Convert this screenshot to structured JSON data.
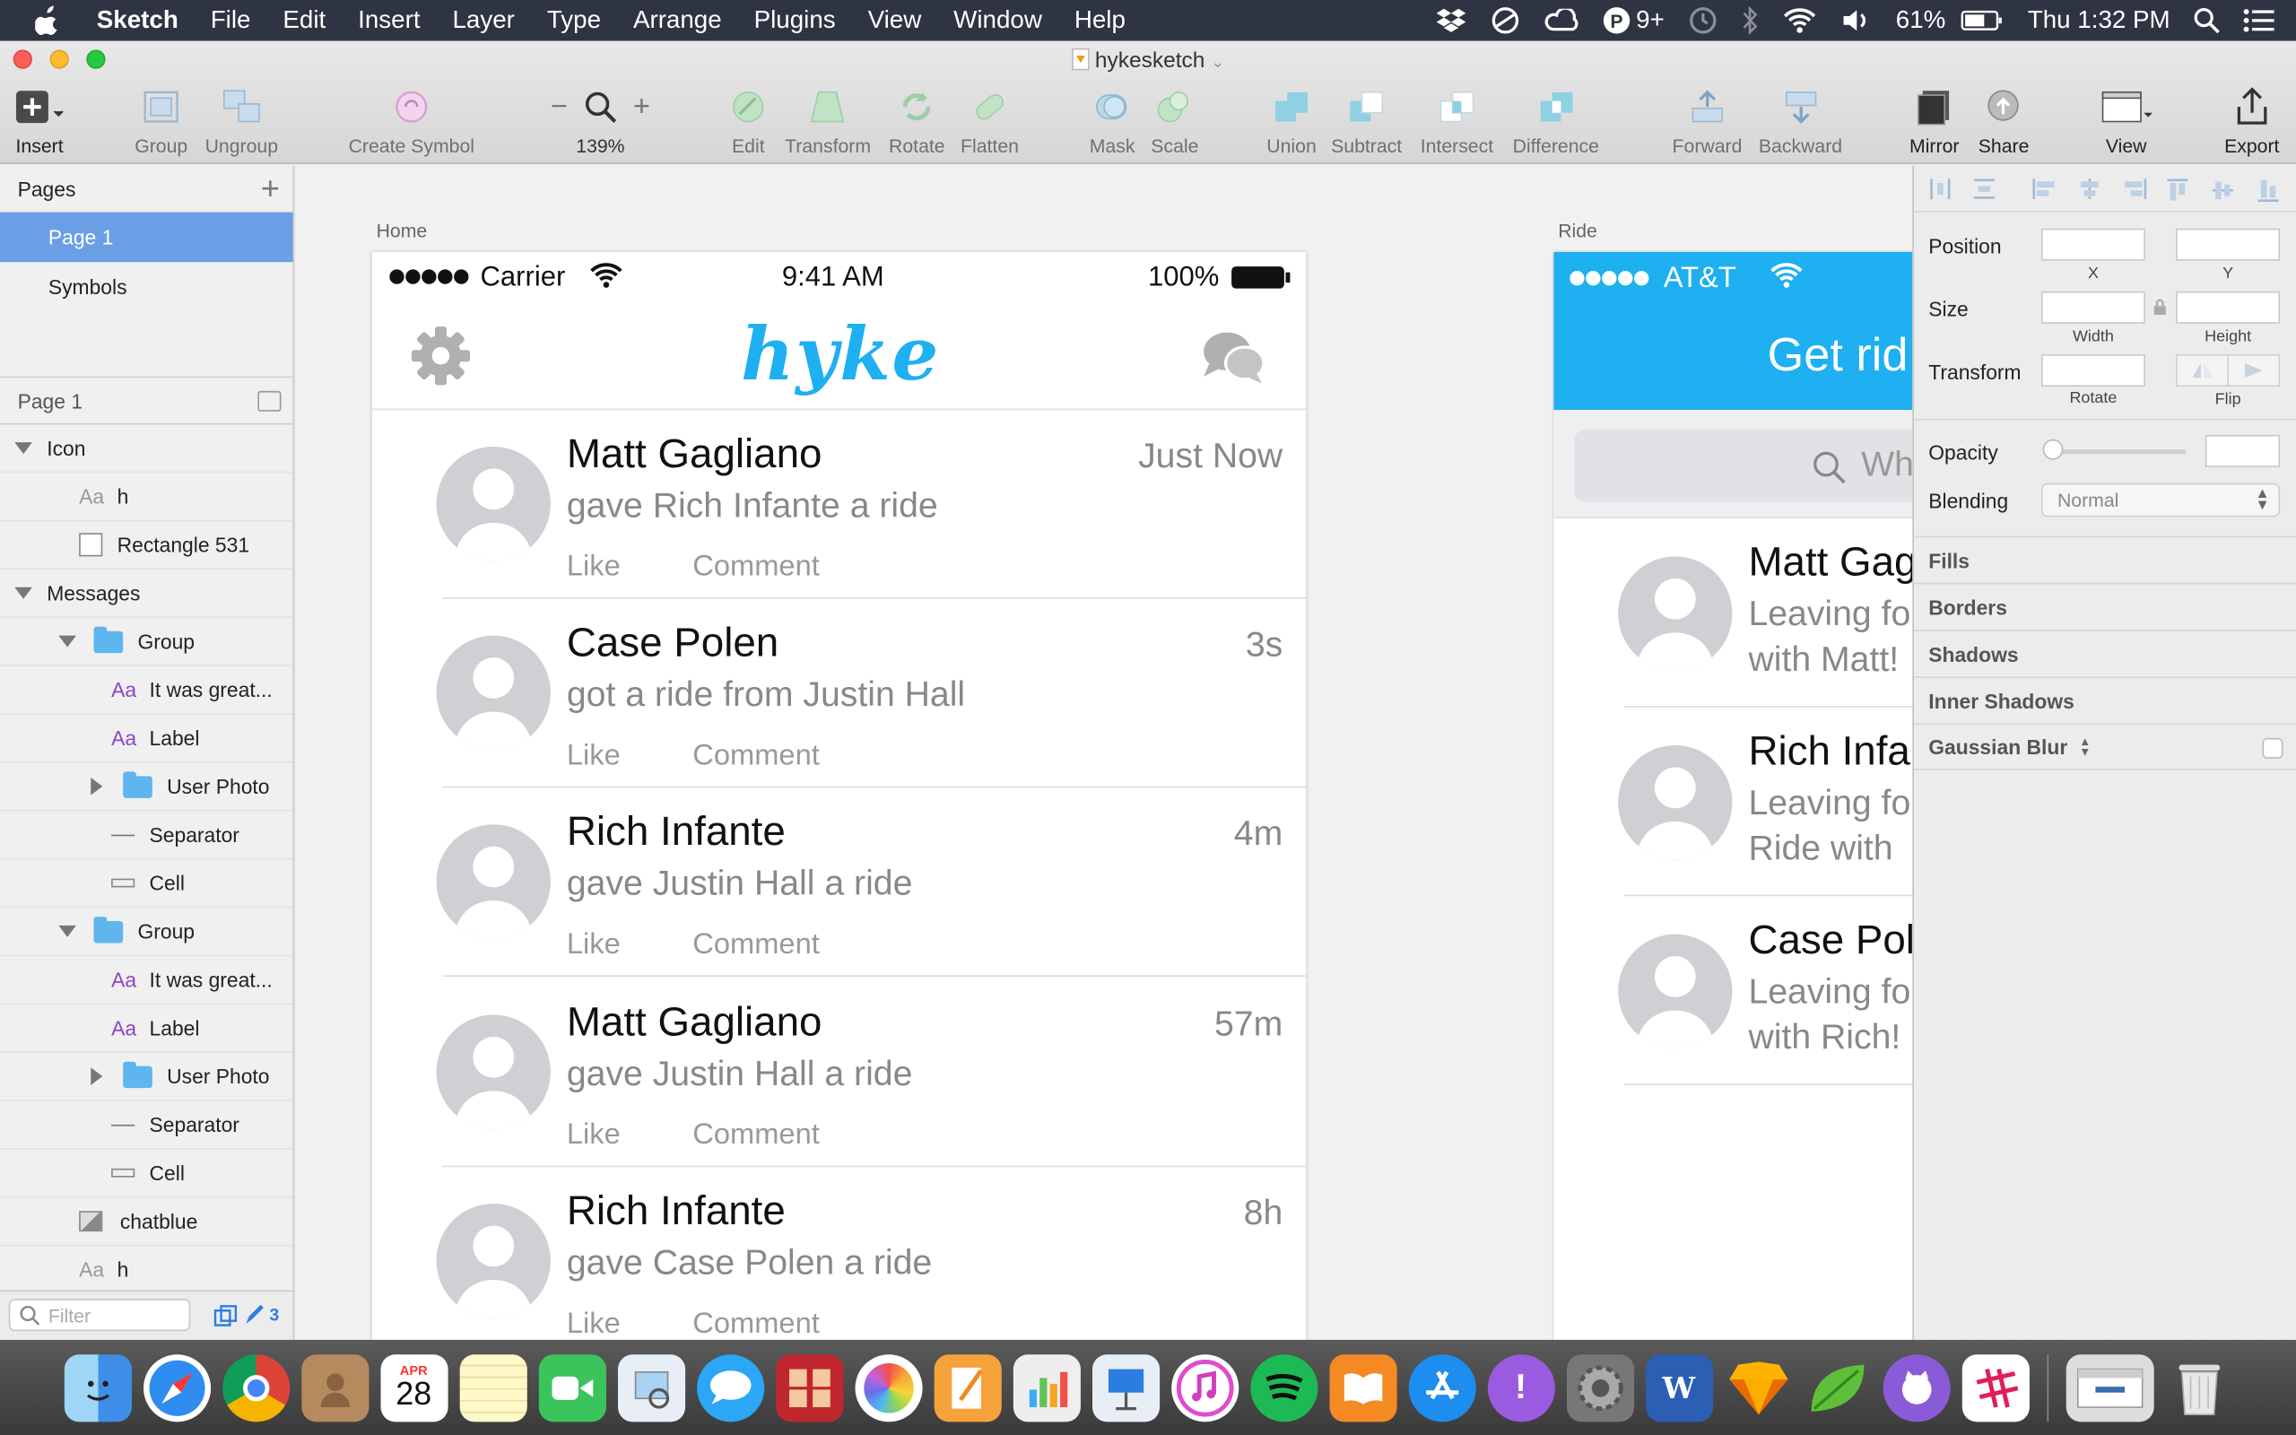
{
  "menubar": {
    "app": "Sketch",
    "menus": [
      "File",
      "Edit",
      "Insert",
      "Layer",
      "Type",
      "Arrange",
      "Plugins",
      "View",
      "Window",
      "Help"
    ],
    "status": {
      "notif_count": "9+",
      "battery": "61%",
      "clock": "Thu 1:32 PM"
    }
  },
  "window": {
    "title": "hykesketch",
    "toolbar": {
      "insert": "Insert",
      "group": "Group",
      "ungroup": "Ungroup",
      "create_symbol": "Create Symbol",
      "zoom": "139%",
      "edit": "Edit",
      "transform": "Transform",
      "rotate": "Rotate",
      "flatten": "Flatten",
      "mask": "Mask",
      "scale": "Scale",
      "union": "Union",
      "subtract": "Subtract",
      "intersect": "Intersect",
      "difference": "Difference",
      "forward": "Forward",
      "backward": "Backward",
      "mirror": "Mirror",
      "share": "Share",
      "view": "View",
      "export": "Export"
    }
  },
  "sidebar": {
    "pages_header": "Pages",
    "pages": [
      "Page 1",
      "Symbols"
    ],
    "layers_header": "Page 1",
    "filter_placeholder": "Filter",
    "filter_count": "3",
    "layers": [
      {
        "label": "Icon",
        "kind": "group-open",
        "indent": 0
      },
      {
        "label": "h",
        "kind": "text-gray",
        "indent": 1
      },
      {
        "label": "Rectangle 531",
        "kind": "rect",
        "indent": 1
      },
      {
        "label": "Messages",
        "kind": "group-open",
        "indent": 0
      },
      {
        "label": "Group",
        "kind": "folder-open",
        "indent": 1
      },
      {
        "label": "It was great...",
        "kind": "text",
        "indent": 2
      },
      {
        "label": "Label",
        "kind": "text",
        "indent": 2
      },
      {
        "label": "User Photo",
        "kind": "folder-closed",
        "indent": 2
      },
      {
        "label": "Separator",
        "kind": "line",
        "indent": 2
      },
      {
        "label": "Cell",
        "kind": "cell",
        "indent": 2
      },
      {
        "label": "Group",
        "kind": "folder-open",
        "indent": 1
      },
      {
        "label": "It was great...",
        "kind": "text",
        "indent": 2
      },
      {
        "label": "Label",
        "kind": "text",
        "indent": 2
      },
      {
        "label": "User Photo",
        "kind": "folder-closed",
        "indent": 2
      },
      {
        "label": "Separator",
        "kind": "line",
        "indent": 2
      },
      {
        "label": "Cell",
        "kind": "cell",
        "indent": 2
      },
      {
        "label": "chatblue",
        "kind": "image",
        "indent": 1
      },
      {
        "label": "h",
        "kind": "text-gray",
        "indent": 1
      }
    ]
  },
  "canvas": {
    "home_label": "Home",
    "ride_label": "Ride",
    "home": {
      "carrier": "Carrier",
      "time": "9:41 AM",
      "battery": "100%",
      "logo": "hyke",
      "feed": [
        {
          "name": "Matt Gagliano",
          "action": "gave Rich Infante a ride",
          "time": "Just Now",
          "like": "Like",
          "comment": "Comment"
        },
        {
          "name": "Case Polen",
          "action": "got a ride from Justin Hall",
          "time": "3s",
          "like": "Like",
          "comment": "Comment"
        },
        {
          "name": "Rich Infante",
          "action": "gave Justin Hall a ride",
          "time": "4m",
          "like": "Like",
          "comment": "Comment"
        },
        {
          "name": "Matt Gagliano",
          "action": "gave Justin Hall a ride",
          "time": "57m",
          "like": "Like",
          "comment": "Comment"
        },
        {
          "name": "Rich Infante",
          "action": "gave Case Polen a ride",
          "time": "8h",
          "like": "Like",
          "comment": "Comment"
        }
      ]
    },
    "ride": {
      "carrier": "AT&T",
      "header": "Get rid",
      "search": "Wh",
      "rows": [
        {
          "name": "Matt Gag",
          "line1": "Leaving fo",
          "line2": "with Matt!"
        },
        {
          "name": "Rich Infar",
          "line1": "Leaving fo",
          "line2": "Ride with"
        },
        {
          "name": "Case Pole",
          "line1": "Leaving fo",
          "line2": "with Rich!"
        }
      ]
    }
  },
  "inspector": {
    "position": "Position",
    "x": "X",
    "y": "Y",
    "size": "Size",
    "width": "Width",
    "height": "Height",
    "transform": "Transform",
    "rotate": "Rotate",
    "flip": "Flip",
    "opacity": "Opacity",
    "blending": "Blending",
    "blending_value": "Normal",
    "fills": "Fills",
    "borders": "Borders",
    "shadows": "Shadows",
    "inner_shadows": "Inner Shadows",
    "gaussian_blur": "Gaussian Blur"
  },
  "dock": {
    "calendar_month": "APR",
    "calendar_day": "28"
  },
  "colors": {
    "accent": "#1eb0f0",
    "selection": "#6a9fe6",
    "menubar": "#2e3441"
  }
}
